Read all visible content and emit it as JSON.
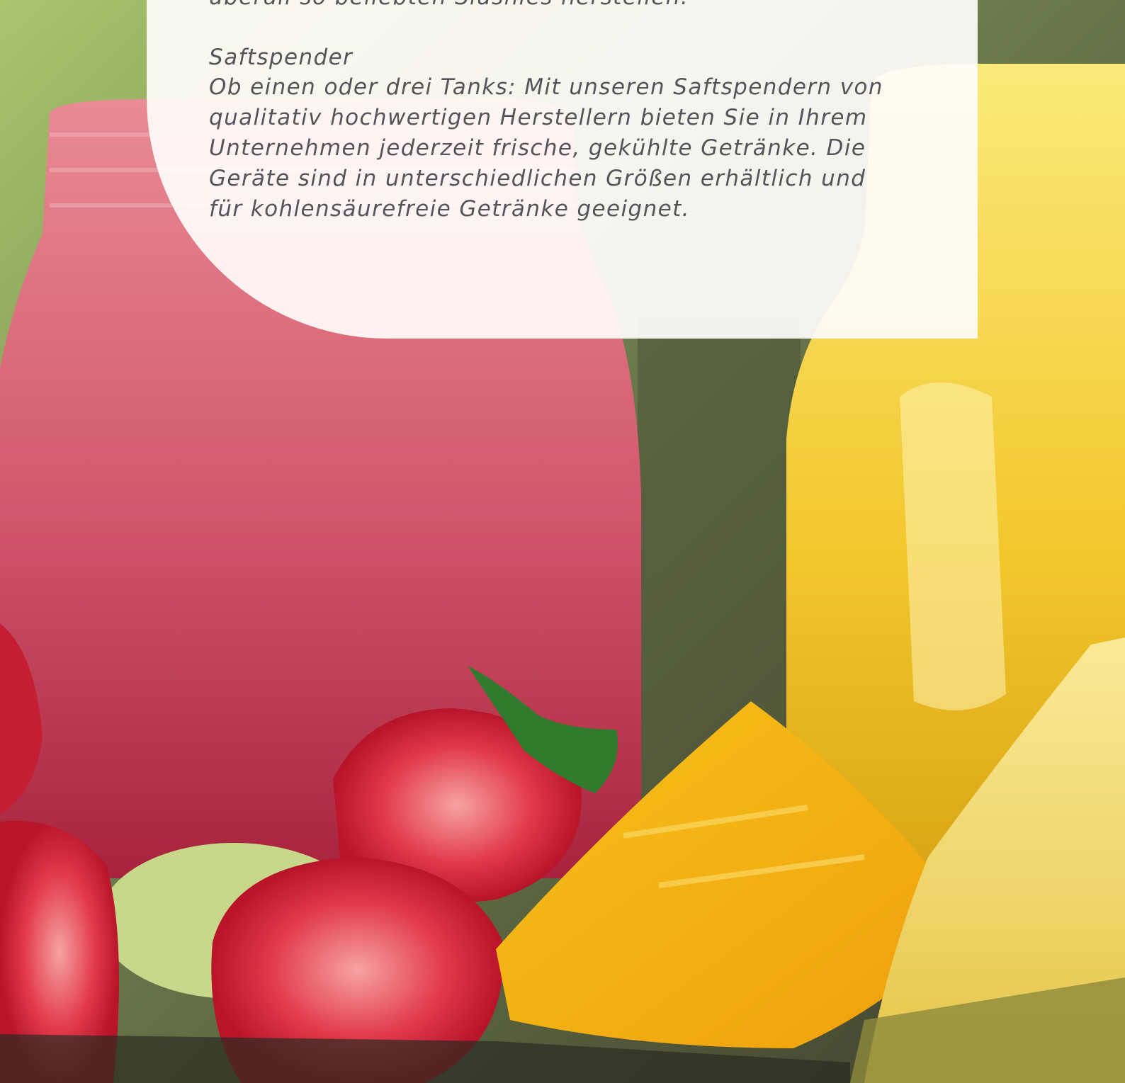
{
  "content": {
    "intro_tail": "überall so beliebten Slushies herstellen.",
    "section_title": "Saftspender",
    "section_body": "Ob einen oder drei Tanks: Mit unseren Saftspendern von qualitativ hochwertigen Herstellern bieten Sie in Ihrem Unternehmen jederzeit frische, gekühlte Getränke. Die Geräte sind in unterschiedlichen Größen erhältlich und für kohlensäurefreie Getränke geeignet."
  },
  "colors": {
    "text": "#55545a",
    "card": "#fffcfa",
    "berry_drink": "#d35a6e",
    "mango_drink": "#f2c72c",
    "background_green": "#7a8f52"
  }
}
